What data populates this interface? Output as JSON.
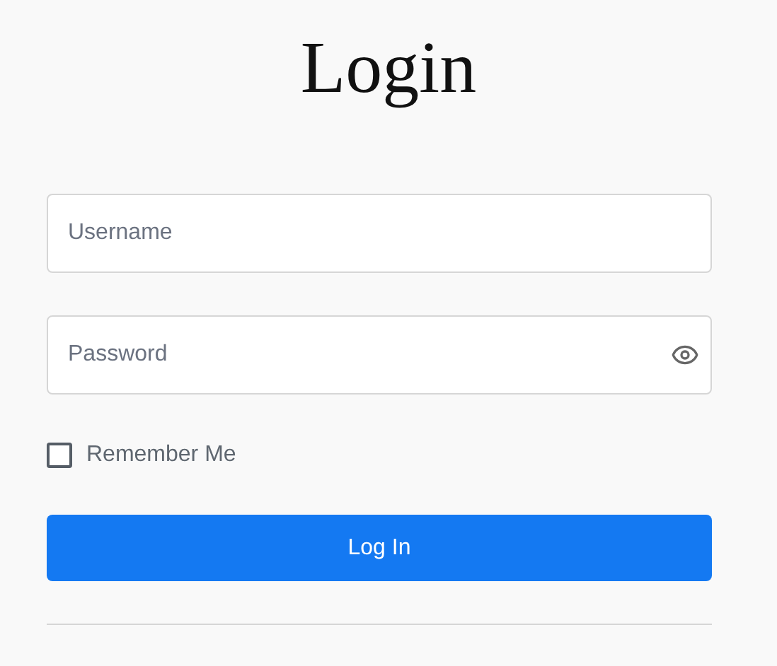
{
  "title": "Login",
  "fields": [
    {
      "kind": "text",
      "placeholder": "Username"
    },
    {
      "kind": "password",
      "placeholder": "Password"
    }
  ],
  "remember": {
    "label": "Remember Me",
    "checked": false
  },
  "submit": {
    "label": "Log In"
  }
}
